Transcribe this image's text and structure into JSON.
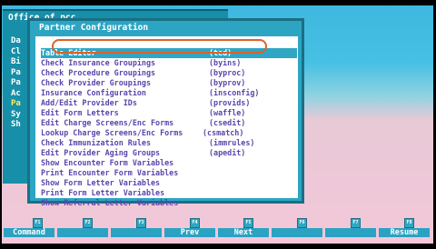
{
  "outer_window": {
    "title": "Office of pcc",
    "left_items": [
      "Da",
      "Cl",
      "Bi",
      "Pa",
      "Pa",
      "Ac",
      "Pa",
      "Sy",
      "Sh"
    ]
  },
  "menu": {
    "title": "Partner Configuration",
    "items": [
      {
        "label": "Table Editor",
        "code": "(ted)"
      },
      {
        "label": "Check Insurance Groupings",
        "code": "(byins)"
      },
      {
        "label": "Check Procedure Groupings",
        "code": "(byproc)"
      },
      {
        "label": "Check Provider Groupings",
        "code": "(byprov)"
      },
      {
        "label": "Insurance Configuration",
        "code": "(insconfig)"
      },
      {
        "label": "Add/Edit Provider IDs",
        "code": "(provids)"
      },
      {
        "label": "Edit Form Letters",
        "code": "(waffle)"
      },
      {
        "label": "Edit Charge Screens/Enc Forms",
        "code": "(csedit)"
      },
      {
        "label": "Lookup Charge Screens/Enc Forms",
        "code": "(csmatch)"
      },
      {
        "label": "Check Immunization Rules",
        "code": "(immrules)"
      },
      {
        "label": "Edit Provider Aging Groups",
        "code": "(apedit)"
      },
      {
        "label": "Show Encounter Form Variables",
        "code": ""
      },
      {
        "label": "Print Encounter Form Variables",
        "code": ""
      },
      {
        "label": "Show Form Letter Variables",
        "code": ""
      },
      {
        "label": "Print Form Letter Variables",
        "code": ""
      },
      {
        "label": "Show Referral Letter Variables",
        "code": ""
      }
    ]
  },
  "function_keys": [
    {
      "key": "F1",
      "label": "Command"
    },
    {
      "key": "F2",
      "label": ""
    },
    {
      "key": "F3",
      "label": ""
    },
    {
      "key": "F4",
      "label": "Prev"
    },
    {
      "key": "F5",
      "label": "Next"
    },
    {
      "key": "F6",
      "label": ""
    },
    {
      "key": "F7",
      "label": ""
    },
    {
      "key": "F8",
      "label": "Resume"
    }
  ],
  "scroll_indicators": {
    "up": "/\\",
    "down": "\\/"
  }
}
